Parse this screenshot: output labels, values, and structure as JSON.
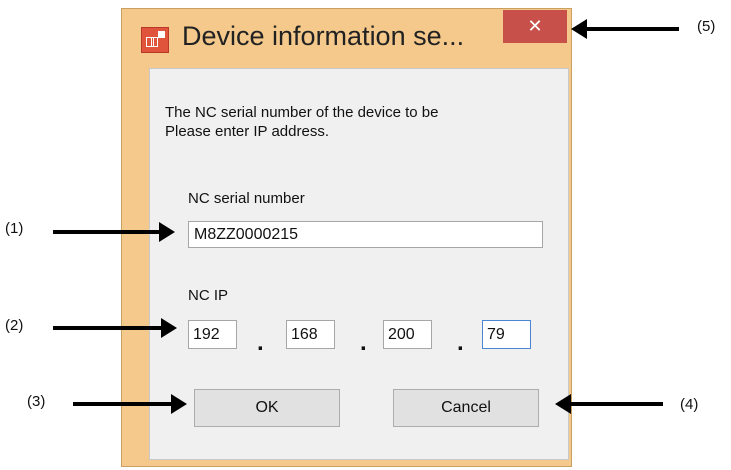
{
  "window": {
    "title": "Device information se...",
    "close_glyph": "✕",
    "close_color": "#c7504a",
    "frame_color": "#f4c98b",
    "icon": "app-device-icon"
  },
  "dialog": {
    "message_line1": "The NC serial number of the device to be",
    "message_line2": "Please enter IP address.",
    "serial_label": "NC serial number",
    "serial_value": "M8ZZ0000215",
    "ip_label": "NC IP",
    "ip_octets": [
      "192",
      "168",
      "200",
      "79"
    ],
    "ip_separator": ".",
    "ok_label": "OK",
    "cancel_label": "Cancel"
  },
  "callouts": {
    "c1": "(1)",
    "c2": "(2)",
    "c3": "(3)",
    "c4": "(4)",
    "c5": "(5)"
  }
}
